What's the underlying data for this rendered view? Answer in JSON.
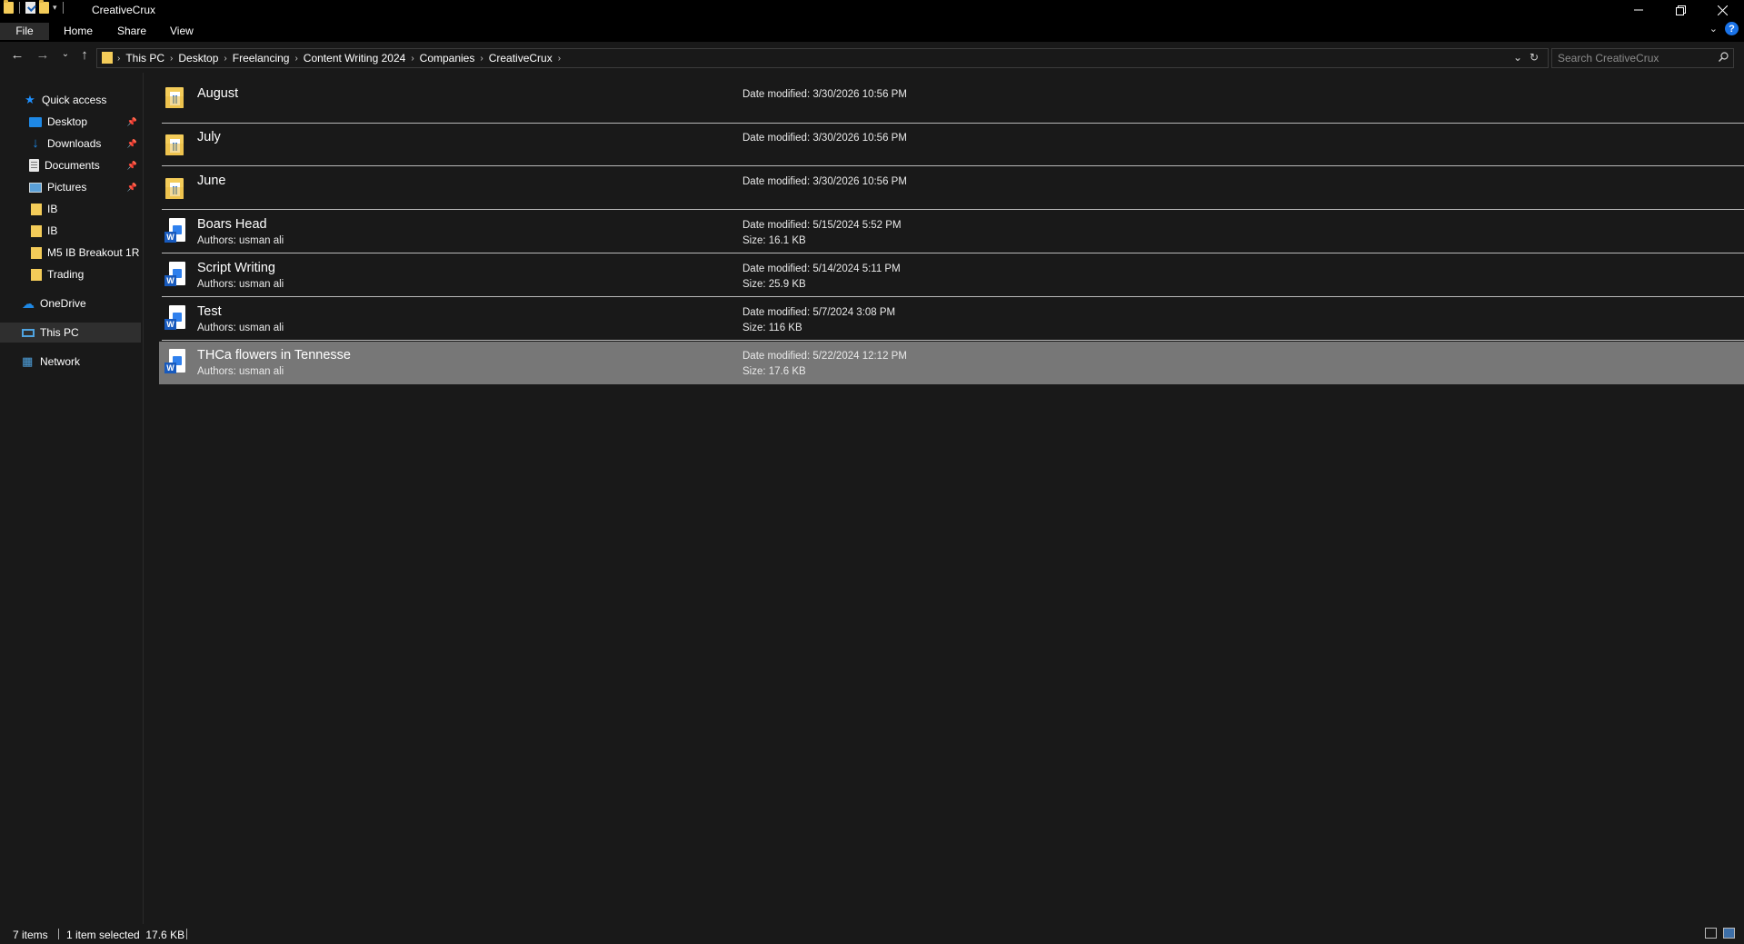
{
  "window": {
    "title": "CreativeCrux",
    "minimize_icon": "minimize-icon",
    "restore_icon": "restore-icon",
    "close_icon": "close-icon"
  },
  "ribbon": {
    "tabs": [
      "File",
      "Home",
      "Share",
      "View"
    ],
    "help_label": "?"
  },
  "address": {
    "crumbs": [
      "This PC",
      "Desktop",
      "Freelancing",
      "Content Writing 2024",
      "Companies",
      "CreativeCrux"
    ]
  },
  "search": {
    "placeholder": "Search CreativeCrux"
  },
  "sidebar": {
    "quick_access": "Quick access",
    "pinned": [
      {
        "label": "Desktop",
        "icon": "desktop-icon"
      },
      {
        "label": "Downloads",
        "icon": "downloads-icon"
      },
      {
        "label": "Documents",
        "icon": "documents-icon"
      },
      {
        "label": "Pictures",
        "icon": "pictures-icon"
      }
    ],
    "folders": [
      "IB",
      "IB",
      "M5 IB Breakout 1R",
      "Trading"
    ],
    "onedrive": "OneDrive",
    "this_pc": "This PC",
    "network": "Network"
  },
  "files": [
    {
      "name": "August",
      "type": "folder",
      "date": "Date modified: 3/30/2026 10:56 PM"
    },
    {
      "name": "July",
      "type": "folder",
      "date": "Date modified: 3/30/2026 10:56 PM"
    },
    {
      "name": "June",
      "type": "folder",
      "date": "Date modified: 3/30/2026 10:56 PM"
    },
    {
      "name": "Boars Head",
      "type": "word",
      "author": "Authors: usman ali",
      "date": "Date modified: 5/15/2024 5:52 PM",
      "size": "Size: 16.1 KB"
    },
    {
      "name": "Script Writing",
      "type": "word",
      "author": "Authors: usman ali",
      "date": "Date modified: 5/14/2024 5:11 PM",
      "size": "Size: 25.9 KB"
    },
    {
      "name": "Test",
      "type": "word",
      "author": "Authors: usman ali",
      "date": "Date modified: 5/7/2024 3:08 PM",
      "size": "Size: 116 KB"
    },
    {
      "name": "THCa flowers in Tennesse",
      "type": "word",
      "author": "Authors: usman ali",
      "date": "Date modified: 5/22/2024 12:12 PM",
      "size": "Size: 17.6 KB",
      "selected": true
    }
  ],
  "status": {
    "item_count": "7 items",
    "selection": "1 item selected  17.6 KB"
  },
  "colors": {
    "selected_row": "#777777",
    "background": "#191919",
    "folder": "#f4cc59",
    "word": "#185abd"
  }
}
